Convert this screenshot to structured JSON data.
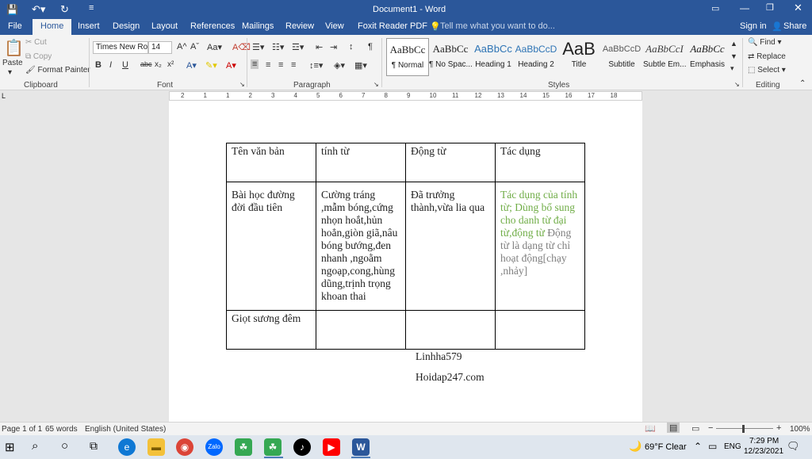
{
  "title_bar": {
    "doc_title": "Document1  -  Word",
    "user": "Sign in",
    "share": "Share"
  },
  "tabs": [
    "File",
    "Home",
    "Insert",
    "Design",
    "Layout",
    "References",
    "Mailings",
    "Review",
    "View",
    "Foxit Reader PDF"
  ],
  "tell_me": "Tell me what you want to do...",
  "clipboard": {
    "paste": "Paste",
    "cut": "Cut",
    "copy": "Copy",
    "format_painter": "Format Painter",
    "label": "Clipboard"
  },
  "font": {
    "name": "Times New Ro",
    "size": "14",
    "label": "Font",
    "bold": "B",
    "italic": "I",
    "underline": "U",
    "strike": "abc",
    "sub": "x₂",
    "sup": "x²"
  },
  "paragraph": {
    "label": "Paragraph"
  },
  "styles": {
    "label": "Styles",
    "items": [
      {
        "preview": "AaBbCc",
        "name": "¶ Normal"
      },
      {
        "preview": "AaBbCc",
        "name": "¶ No Spac..."
      },
      {
        "preview": "AaBbCc",
        "name": "Heading 1"
      },
      {
        "preview": "AaBbCcD",
        "name": "Heading 2"
      },
      {
        "preview": "AaB",
        "name": "Title"
      },
      {
        "preview": "AaBbCcD",
        "name": "Subtitle"
      },
      {
        "preview": "AaBbCcI",
        "name": "Subtle Em..."
      },
      {
        "preview": "AaBbCc",
        "name": "Emphasis"
      }
    ]
  },
  "editing": {
    "find": "Find",
    "replace": "Replace",
    "select": "Select",
    "label": "Editing"
  },
  "ruler_nums": [
    "2",
    "1",
    "1",
    "2",
    "3",
    "4",
    "5",
    "6",
    "7",
    "8",
    "9",
    "10",
    "11",
    "12",
    "13",
    "14",
    "15",
    "16",
    "17",
    "18"
  ],
  "table": {
    "header": [
      "Tên văn bản",
      "tính từ",
      "Động từ",
      "Tác dụng"
    ],
    "row1": {
      "c1": "Bài học đường đời đầu tiên",
      "c2": "Cường tráng ,mẫm bóng,cứng nhọn hoắt,hủn hoẳn,giòn giã,nâu bóng bướng,đen nhanh ,ngoằm ngoạp,cong,hùng dũng,trịnh trọng khoan thai",
      "c3": "Đã trưởng thành,vừa lia qua",
      "c4_green": "Tác dụng của tính từ; Dùng bổ sung cho danh từ đại từ,động từ",
      "c4_gray": "Động từ là dạng từ chỉ hoạt động[chạy ,nhảy]"
    },
    "row2": {
      "c1": "Giọt sương đêm",
      "c2": "",
      "c3": "",
      "c4": ""
    }
  },
  "paragraphs": [
    "Linhha579",
    "Hoidap247.com"
  ],
  "status": {
    "page": "Page 1 of 1",
    "words": "65 words",
    "lang": "English (United States)",
    "zoom": "100%"
  },
  "taskbar": {
    "weather": "69°F  Clear",
    "lang": "ENG",
    "time": "7:29 PM",
    "date": "12/23/2021"
  },
  "colors": {
    "word_blue": "#2b579a",
    "green_text": "#70ad47",
    "gray_text": "#7f7f7f"
  }
}
